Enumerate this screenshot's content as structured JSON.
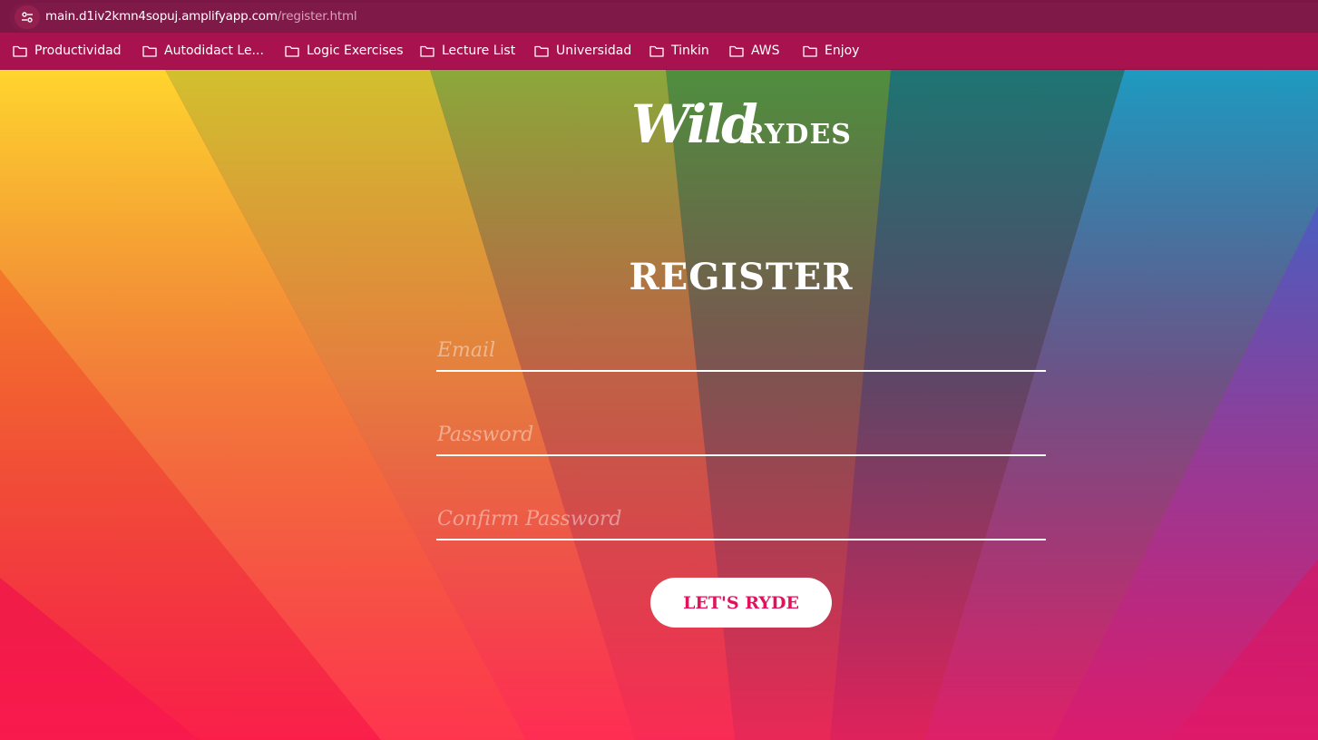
{
  "browser": {
    "url_host": "main.d1iv2kmn4sopuj.amplifyapp.com",
    "url_path": "/register.html",
    "site_info_icon": "tune-icon"
  },
  "bookmarks": [
    {
      "label": "Productividad",
      "icon": "folder-icon"
    },
    {
      "label": "Autodidact Le...",
      "icon": "folder-icon"
    },
    {
      "label": "Logic Exercises",
      "icon": "folder-icon"
    },
    {
      "label": "Lecture List",
      "icon": "folder-icon"
    },
    {
      "label": "Universidad",
      "icon": "folder-icon"
    },
    {
      "label": "Tinkin",
      "icon": "folder-icon"
    },
    {
      "label": "AWS",
      "icon": "folder-icon"
    },
    {
      "label": "Enjoy",
      "icon": "folder-icon"
    }
  ],
  "logo": {
    "script": "Wild",
    "caps": "RYDES"
  },
  "form": {
    "title": "REGISTER",
    "email_placeholder": "Email",
    "password_placeholder": "Password",
    "confirm_placeholder": "Confirm Password",
    "submit_label": "LET'S RYDE"
  },
  "colors": {
    "browser_bar": "#7a1745",
    "bookmarks_bar": "#a8134f",
    "button_text": "#e0125a",
    "button_bg": "#ffffff"
  }
}
